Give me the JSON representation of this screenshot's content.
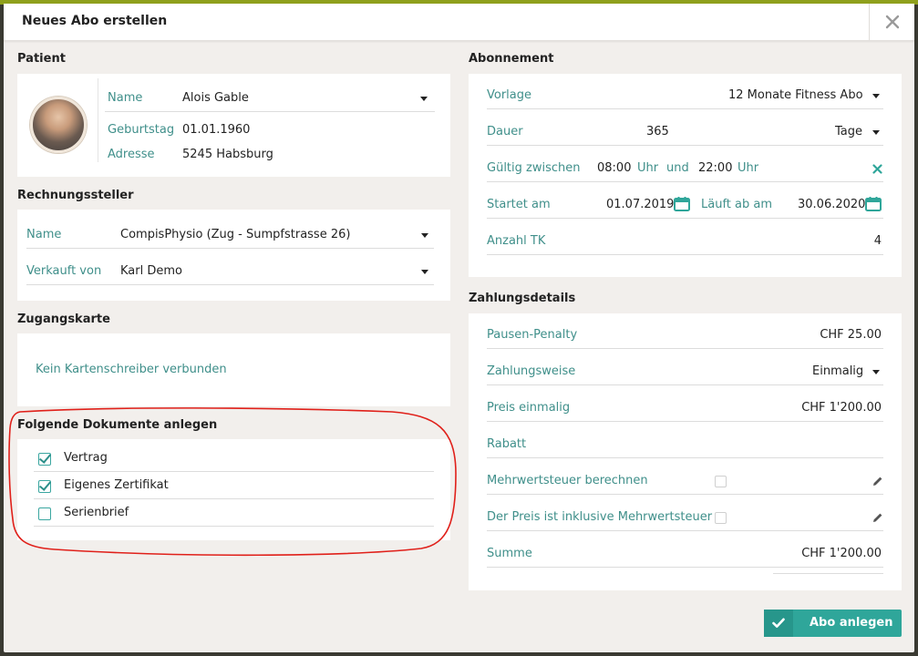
{
  "modal": {
    "title": "Neues Abo erstellen"
  },
  "patient": {
    "section": "Patient",
    "name_label": "Name",
    "name_value": "Alois Gable",
    "birthday_label": "Geburtstag",
    "birthday_value": "01.01.1960",
    "address_label": "Adresse",
    "address_value": "5245 Habsburg"
  },
  "billing": {
    "section": "Rechnungssteller",
    "name_label": "Name",
    "name_value": "CompisPhysio (Zug - Sumpfstrasse 26)",
    "sold_label": "Verkauft von",
    "sold_value": "Karl Demo"
  },
  "access": {
    "section": "Zugangskarte",
    "message": "Kein Kartenschreiber verbunden"
  },
  "documents": {
    "section": "Folgende Dokumente anlegen",
    "items": [
      {
        "label": "Vertrag",
        "checked": true
      },
      {
        "label": "Eigenes Zertifikat",
        "checked": true
      },
      {
        "label": "Serienbrief",
        "checked": false
      }
    ]
  },
  "subscription": {
    "section": "Abonnement",
    "template_label": "Vorlage",
    "template_value": "12 Monate Fitness Abo",
    "duration_label": "Dauer",
    "duration_value": "365",
    "duration_unit": "Tage",
    "valid_label": "Gültig zwischen",
    "valid_from": "08:00",
    "uhr1": "Uhr",
    "und": "und",
    "valid_to": "22:00",
    "uhr2": "Uhr",
    "start_label": "Startet am",
    "start_value": "01.07.2019",
    "end_label": "Läuft ab am",
    "end_value": "30.06.2020",
    "tk_label": "Anzahl TK",
    "tk_value": "4"
  },
  "payment": {
    "section": "Zahlungsdetails",
    "penalty_label": "Pausen-Penalty",
    "penalty_value": "CHF 25.00",
    "method_label": "Zahlungsweise",
    "method_value": "Einmalig",
    "price_label": "Preis einmalig",
    "price_value": "CHF 1'200.00",
    "discount_label": "Rabatt",
    "vat_label": "Mehrwertsteuer berechnen",
    "incl_label": "Der Preis ist inklusive Mehrwertsteuer",
    "sum_label": "Summe",
    "sum_value": "CHF 1'200.00"
  },
  "actions": {
    "create_label": "Abo anlegen"
  },
  "colors": {
    "accent": "#2fa69a",
    "label": "#3f8f8a",
    "annotation": "#e0201a"
  }
}
